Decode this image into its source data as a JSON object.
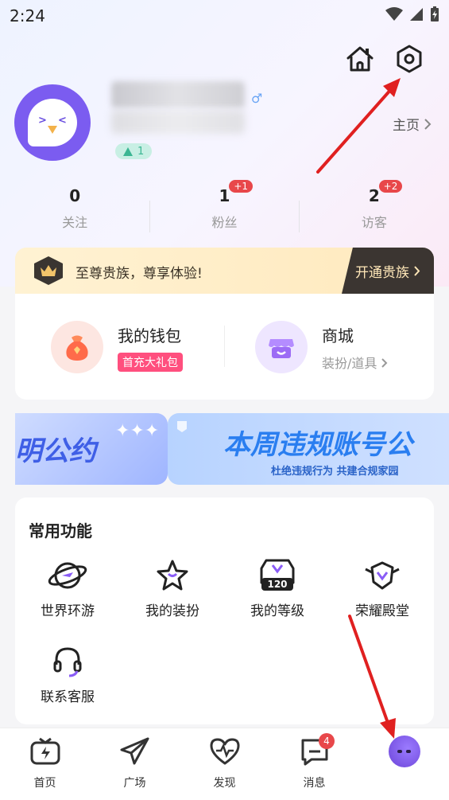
{
  "status_bar": {
    "time": "2:24"
  },
  "profile": {
    "gender_icon": "male-icon",
    "level": "1",
    "homepage_link": "主页",
    "avatar": "white-bird-avatar"
  },
  "stats": [
    {
      "count": "0",
      "label": "关注",
      "badge": ""
    },
    {
      "count": "1",
      "label": "粉丝",
      "badge": "+1"
    },
    {
      "count": "2",
      "label": "访客",
      "badge": "+2"
    }
  ],
  "vip": {
    "text": "至尊贵族，尊享体验!",
    "button": "开通贵族"
  },
  "wallet": {
    "title": "我的钱包",
    "tag": "首充大礼包"
  },
  "shop": {
    "title": "商城",
    "subtitle": "装扮/道具"
  },
  "banners": {
    "banner1_text": "明公约",
    "banner2_title": "本周违规账号公",
    "banner2_sub": "杜绝违规行为 共建合规家园"
  },
  "functions": {
    "title": "常用功能",
    "items": [
      {
        "label": "世界环游",
        "icon": "planet-plane-icon"
      },
      {
        "label": "我的装扮",
        "icon": "star-outfit-icon"
      },
      {
        "label": "我的等级",
        "icon": "level-badge-icon",
        "level_number": "120"
      },
      {
        "label": "荣耀殿堂",
        "icon": "honor-badge-icon"
      },
      {
        "label": "联系客服",
        "icon": "headset-icon"
      }
    ]
  },
  "tabbar": [
    {
      "label": "首页",
      "icon": "tv-icon"
    },
    {
      "label": "广场",
      "icon": "paper-plane-icon"
    },
    {
      "label": "发现",
      "icon": "heart-pulse-icon"
    },
    {
      "label": "消息",
      "icon": "message-icon",
      "badge": "4"
    },
    {
      "label": "",
      "icon": "me-avatar-icon"
    }
  ],
  "colors": {
    "accent": "#7b5cf0",
    "badge": "#e8474a",
    "annotation_arrow": "#e02020"
  }
}
